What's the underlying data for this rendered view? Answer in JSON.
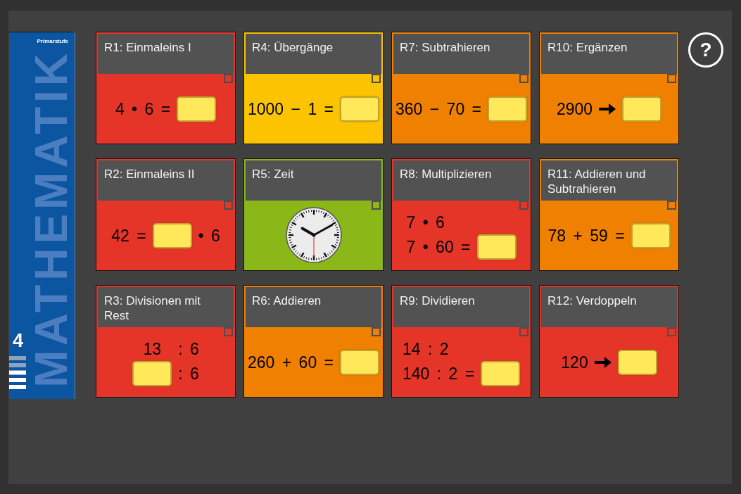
{
  "cover": {
    "subtitle": "Primarstufe",
    "title": "MATHEMATIK",
    "grade": "4"
  },
  "cards": [
    {
      "title": "R1: Einmaleins I",
      "color": "#e53528",
      "checked": false,
      "content": {
        "kind": "equation",
        "lines": [
          [
            {
              "kind": "text",
              "text": "4 • 6 ="
            },
            {
              "kind": "answer"
            }
          ]
        ]
      }
    },
    {
      "title": "R4: Übergänge",
      "color": "#fcc400",
      "checked": false,
      "content": {
        "kind": "equation",
        "lines": [
          [
            {
              "kind": "text",
              "text": "1000 − 1 ="
            },
            {
              "kind": "answer"
            }
          ]
        ]
      }
    },
    {
      "title": "R7: Subtrahieren",
      "color": "#ef8000",
      "checked": false,
      "content": {
        "kind": "equation",
        "lines": [
          [
            {
              "kind": "text",
              "text": "360 − 70 ="
            },
            {
              "kind": "answer"
            }
          ]
        ]
      }
    },
    {
      "title": "R10: Ergänzen",
      "color": "#ef8000",
      "checked": false,
      "content": {
        "kind": "equation",
        "lines": [
          [
            {
              "kind": "text",
              "text": "2900"
            },
            {
              "kind": "arrow"
            },
            {
              "kind": "answer"
            }
          ]
        ]
      }
    },
    {
      "title": "R2: Einmaleins II",
      "color": "#e53528",
      "checked": false,
      "content": {
        "kind": "equation",
        "lines": [
          [
            {
              "kind": "text",
              "text": "42 ="
            },
            {
              "kind": "answer"
            },
            {
              "kind": "text",
              "text": "• 6"
            }
          ]
        ]
      }
    },
    {
      "title": "R5: Zeit",
      "color": "#8bb818",
      "checked": false,
      "content": {
        "kind": "clock"
      }
    },
    {
      "title": "R8: Multiplizieren",
      "color": "#e53528",
      "checked": false,
      "content": {
        "kind": "equation",
        "lines": [
          [
            {
              "kind": "text",
              "text": "7 • 6"
            }
          ],
          [
            {
              "kind": "text",
              "text": "7 • 60 ="
            },
            {
              "kind": "answer"
            }
          ]
        ]
      }
    },
    {
      "title": "R11: Addieren und Subtrahieren",
      "color": "#ef8000",
      "checked": false,
      "content": {
        "kind": "equation",
        "lines": [
          [
            {
              "kind": "text",
              "text": "78 + 59 ="
            },
            {
              "kind": "answer"
            }
          ]
        ]
      }
    },
    {
      "title": "R3: Divisionen mit Rest",
      "color": "#e53528",
      "checked": false,
      "content": {
        "kind": "equation",
        "lines": [
          [
            {
              "kind": "text",
              "text": "13"
            },
            {
              "kind": "text",
              "text": ": 6"
            }
          ],
          [
            {
              "kind": "answer"
            },
            {
              "kind": "text",
              "text": ": 6"
            }
          ]
        ]
      }
    },
    {
      "title": "R6: Addieren",
      "color": "#ef8000",
      "checked": false,
      "content": {
        "kind": "equation",
        "lines": [
          [
            {
              "kind": "text",
              "text": "260 + 60 ="
            },
            {
              "kind": "answer"
            }
          ]
        ]
      }
    },
    {
      "title": "R9: Dividieren",
      "color": "#e53528",
      "checked": false,
      "content": {
        "kind": "equation",
        "lines": [
          [
            {
              "kind": "text",
              "text": "14 : 2"
            }
          ],
          [
            {
              "kind": "text",
              "text": "140 : 2 ="
            },
            {
              "kind": "answer"
            }
          ]
        ]
      }
    },
    {
      "title": "R12: Verdoppeln",
      "color": "#e53528",
      "checked": false,
      "content": {
        "kind": "equation",
        "lines": [
          [
            {
              "kind": "text",
              "text": "120"
            },
            {
              "kind": "arrow"
            },
            {
              "kind": "answer"
            }
          ]
        ]
      }
    }
  ],
  "help_button": {
    "label": "?"
  }
}
